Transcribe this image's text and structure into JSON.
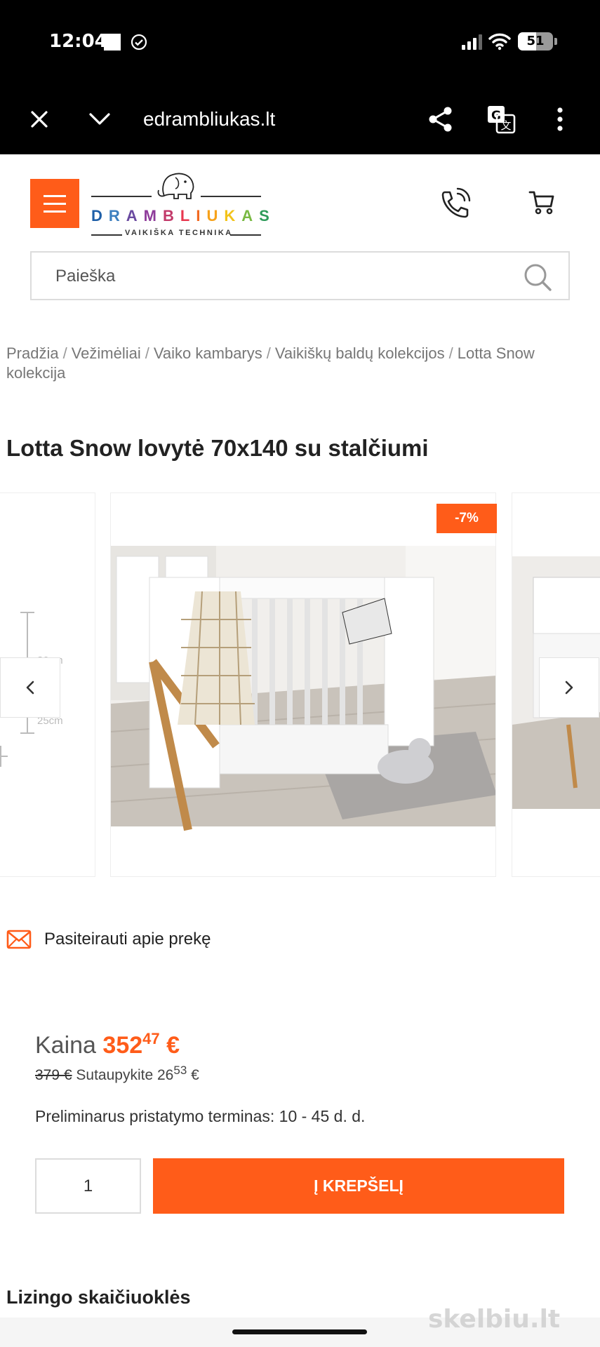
{
  "status_bar": {
    "time": "12:04",
    "battery": "51",
    "battery_fraction": 0.51
  },
  "browser": {
    "url": "edrambliukas.lt"
  },
  "header": {
    "logo": {
      "word_letters": [
        "D",
        "R",
        "A",
        "M",
        "B",
        "L",
        "I",
        "U",
        "K",
        "A",
        "S"
      ],
      "letter_colors": [
        "#1e5fa8",
        "#3d7fbf",
        "#6a4aa0",
        "#8e3b9a",
        "#c23a6a",
        "#e8384f",
        "#f26a21",
        "#f7a21b",
        "#f2c31a",
        "#79b943",
        "#2e9b5a"
      ],
      "tagline": "VAIKIŠKA TECHNIKA"
    },
    "accent_color": "#ff5c19"
  },
  "search": {
    "placeholder": "Paieška"
  },
  "breadcrumb": {
    "items": [
      "Pradžia",
      "Vežimėliai",
      "Vaiko kambarys",
      "Vaikiškų baldų kolekcijos",
      "Lotta Snow kolekcija"
    ],
    "separator": "/"
  },
  "product": {
    "title": "Lotta Snow lovytė 70x140 su stalčiumi",
    "discount_badge": "-7%",
    "side_dims": [
      "30cm",
      "25cm"
    ],
    "inquiry_label": "Pasiteirauti apie prekę",
    "price": {
      "label": "Kaina",
      "main": "352",
      "cents": "47",
      "currency": "€"
    },
    "old_price": "379 €",
    "savings": {
      "label": "Sutaupykite",
      "main": "26",
      "cents": "53",
      "currency": "€"
    },
    "delivery": "Preliminarus pristatymo terminas: 10 - 45 d. d.",
    "quantity": "1",
    "add_to_cart": "Į KREPŠELĮ"
  },
  "sections": {
    "leasing_title": "Lizingo skaičiuoklės"
  },
  "watermark": "skelbiu.lt"
}
